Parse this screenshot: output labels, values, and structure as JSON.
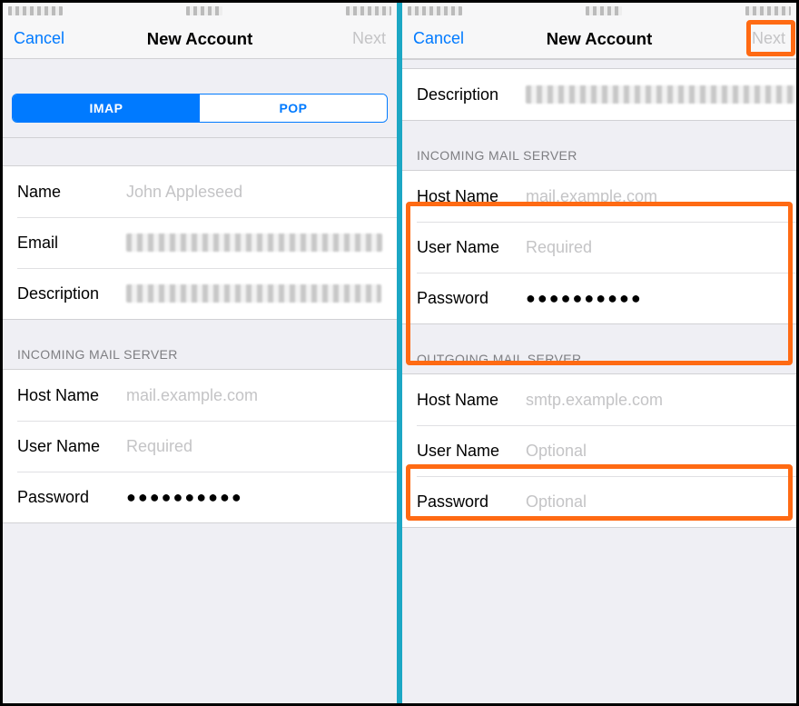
{
  "left": {
    "nav": {
      "cancel": "Cancel",
      "title": "New Account",
      "next": "Next"
    },
    "seg": {
      "imap": "IMAP",
      "pop": "POP"
    },
    "rows": {
      "name_label": "Name",
      "name_placeholder": "John Appleseed",
      "email_label": "Email",
      "desc_label": "Description"
    },
    "incoming_header": "INCOMING MAIL SERVER",
    "incoming": {
      "host_label": "Host Name",
      "host_placeholder": "mail.example.com",
      "user_label": "User Name",
      "user_placeholder": "Required",
      "pass_label": "Password",
      "pass_value": "●●●●●●●●●●"
    }
  },
  "right": {
    "nav": {
      "cancel": "Cancel",
      "title": "New Account",
      "next": "Next"
    },
    "desc_label": "Description",
    "incoming_header": "INCOMING MAIL SERVER",
    "incoming": {
      "host_label": "Host Name",
      "host_placeholder": "mail.example.com",
      "user_label": "User Name",
      "user_placeholder": "Required",
      "pass_label": "Password",
      "pass_value": "●●●●●●●●●●"
    },
    "outgoing_header": "OUTGOING MAIL SERVER",
    "outgoing": {
      "host_label": "Host Name",
      "host_placeholder": "smtp.example.com",
      "user_label": "User Name",
      "user_placeholder": "Optional",
      "pass_label": "Password",
      "pass_placeholder": "Optional"
    }
  }
}
